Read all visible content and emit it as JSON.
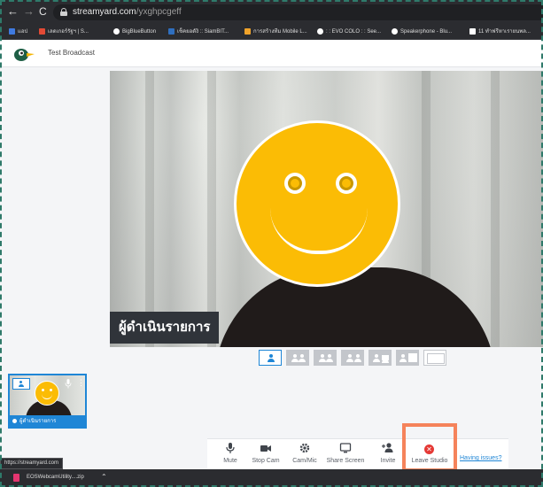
{
  "browser": {
    "url_host": "streamyard.com",
    "url_path": "/yxghpcgeff",
    "bookmarks": [
      {
        "label": "แอป",
        "color": "#3f7ae0"
      },
      {
        "label": "เลดเกอร์รัฐฯ | S...",
        "color": "#e34a35"
      },
      {
        "label": "BigBlueButton",
        "color": "#ffffff"
      },
      {
        "label": "เช็คยอดังิ :: SiamBIT...",
        "color": "#2f6fbf"
      },
      {
        "label": "การสร้างทีม Mobile L...",
        "color": "#f0a32a"
      },
      {
        "label": ": : EVO COLO : : See...",
        "color": "#ffffff"
      },
      {
        "label": "Speakerphone - Blu...",
        "color": "#ffffff"
      },
      {
        "label": "11 ทำฟรีหาเรายนพล...",
        "color": "#ffffff"
      }
    ]
  },
  "app": {
    "title": "Test Broadcast",
    "accent": "#1f86d6"
  },
  "stage": {
    "name_label": "ผู้ดำเนินรายการ"
  },
  "thumbnail": {
    "name_label": "ผู้ดำเนินรายการ",
    "more_icon": "⋮"
  },
  "toolbar": {
    "buttons": [
      {
        "label": "Mute",
        "icon": "mic-icon"
      },
      {
        "label": "Stop Cam",
        "icon": "camera-icon"
      },
      {
        "label": "Cam/Mic",
        "icon": "gear-icon"
      },
      {
        "label": "Share Screen",
        "icon": "monitor-icon"
      },
      {
        "label": "Invite",
        "icon": "add-user-icon"
      }
    ],
    "leave_label": "Leave Studio",
    "issues_link": "Having issues?"
  },
  "status": {
    "link_preview": "https://streamyard.com"
  },
  "download": {
    "file_name": "EOSWebcamUtility....zip"
  }
}
